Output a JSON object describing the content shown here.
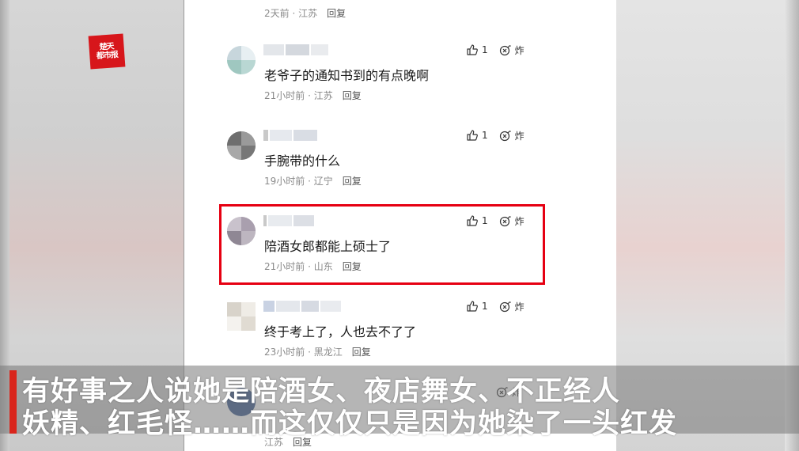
{
  "logo": {
    "text": "楚天都市报"
  },
  "comments": [
    {
      "content": "",
      "time": "2天前",
      "region": "江苏",
      "reply": "回复",
      "likes": "",
      "bomb": ""
    },
    {
      "content": "老爷子的通知书到的有点晚啊",
      "time": "21小时前",
      "region": "江苏",
      "reply": "回复",
      "likes": "1",
      "bomb": "炸"
    },
    {
      "content": "手腕带的什么",
      "time": "19小时前",
      "region": "辽宁",
      "reply": "回复",
      "likes": "1",
      "bomb": "炸"
    },
    {
      "content": "陪酒女郎都能上硕士了",
      "time": "21小时前",
      "region": "山东",
      "reply": "回复",
      "likes": "1",
      "bomb": "炸"
    },
    {
      "content": "终于考上了，人也去不了了",
      "time": "23小时前",
      "region": "黑龙江",
      "reply": "回复",
      "likes": "1",
      "bomb": "炸"
    },
    {
      "content": "",
      "time": "",
      "region": "江苏",
      "reply": "回复",
      "likes": "",
      "bomb": "炸"
    }
  ],
  "caption": {
    "line1": "有好事之人说她是陪酒女、夜店舞女、不正经人",
    "line2": "妖精、红毛怪……而这仅仅只是因为她染了一头红发"
  },
  "colors": {
    "highlight": "#e60012",
    "caption_bar": "#d9251c",
    "logo_bg": "#d7161b"
  },
  "icons": [
    "thumbs-up-icon",
    "bomb-icon"
  ]
}
